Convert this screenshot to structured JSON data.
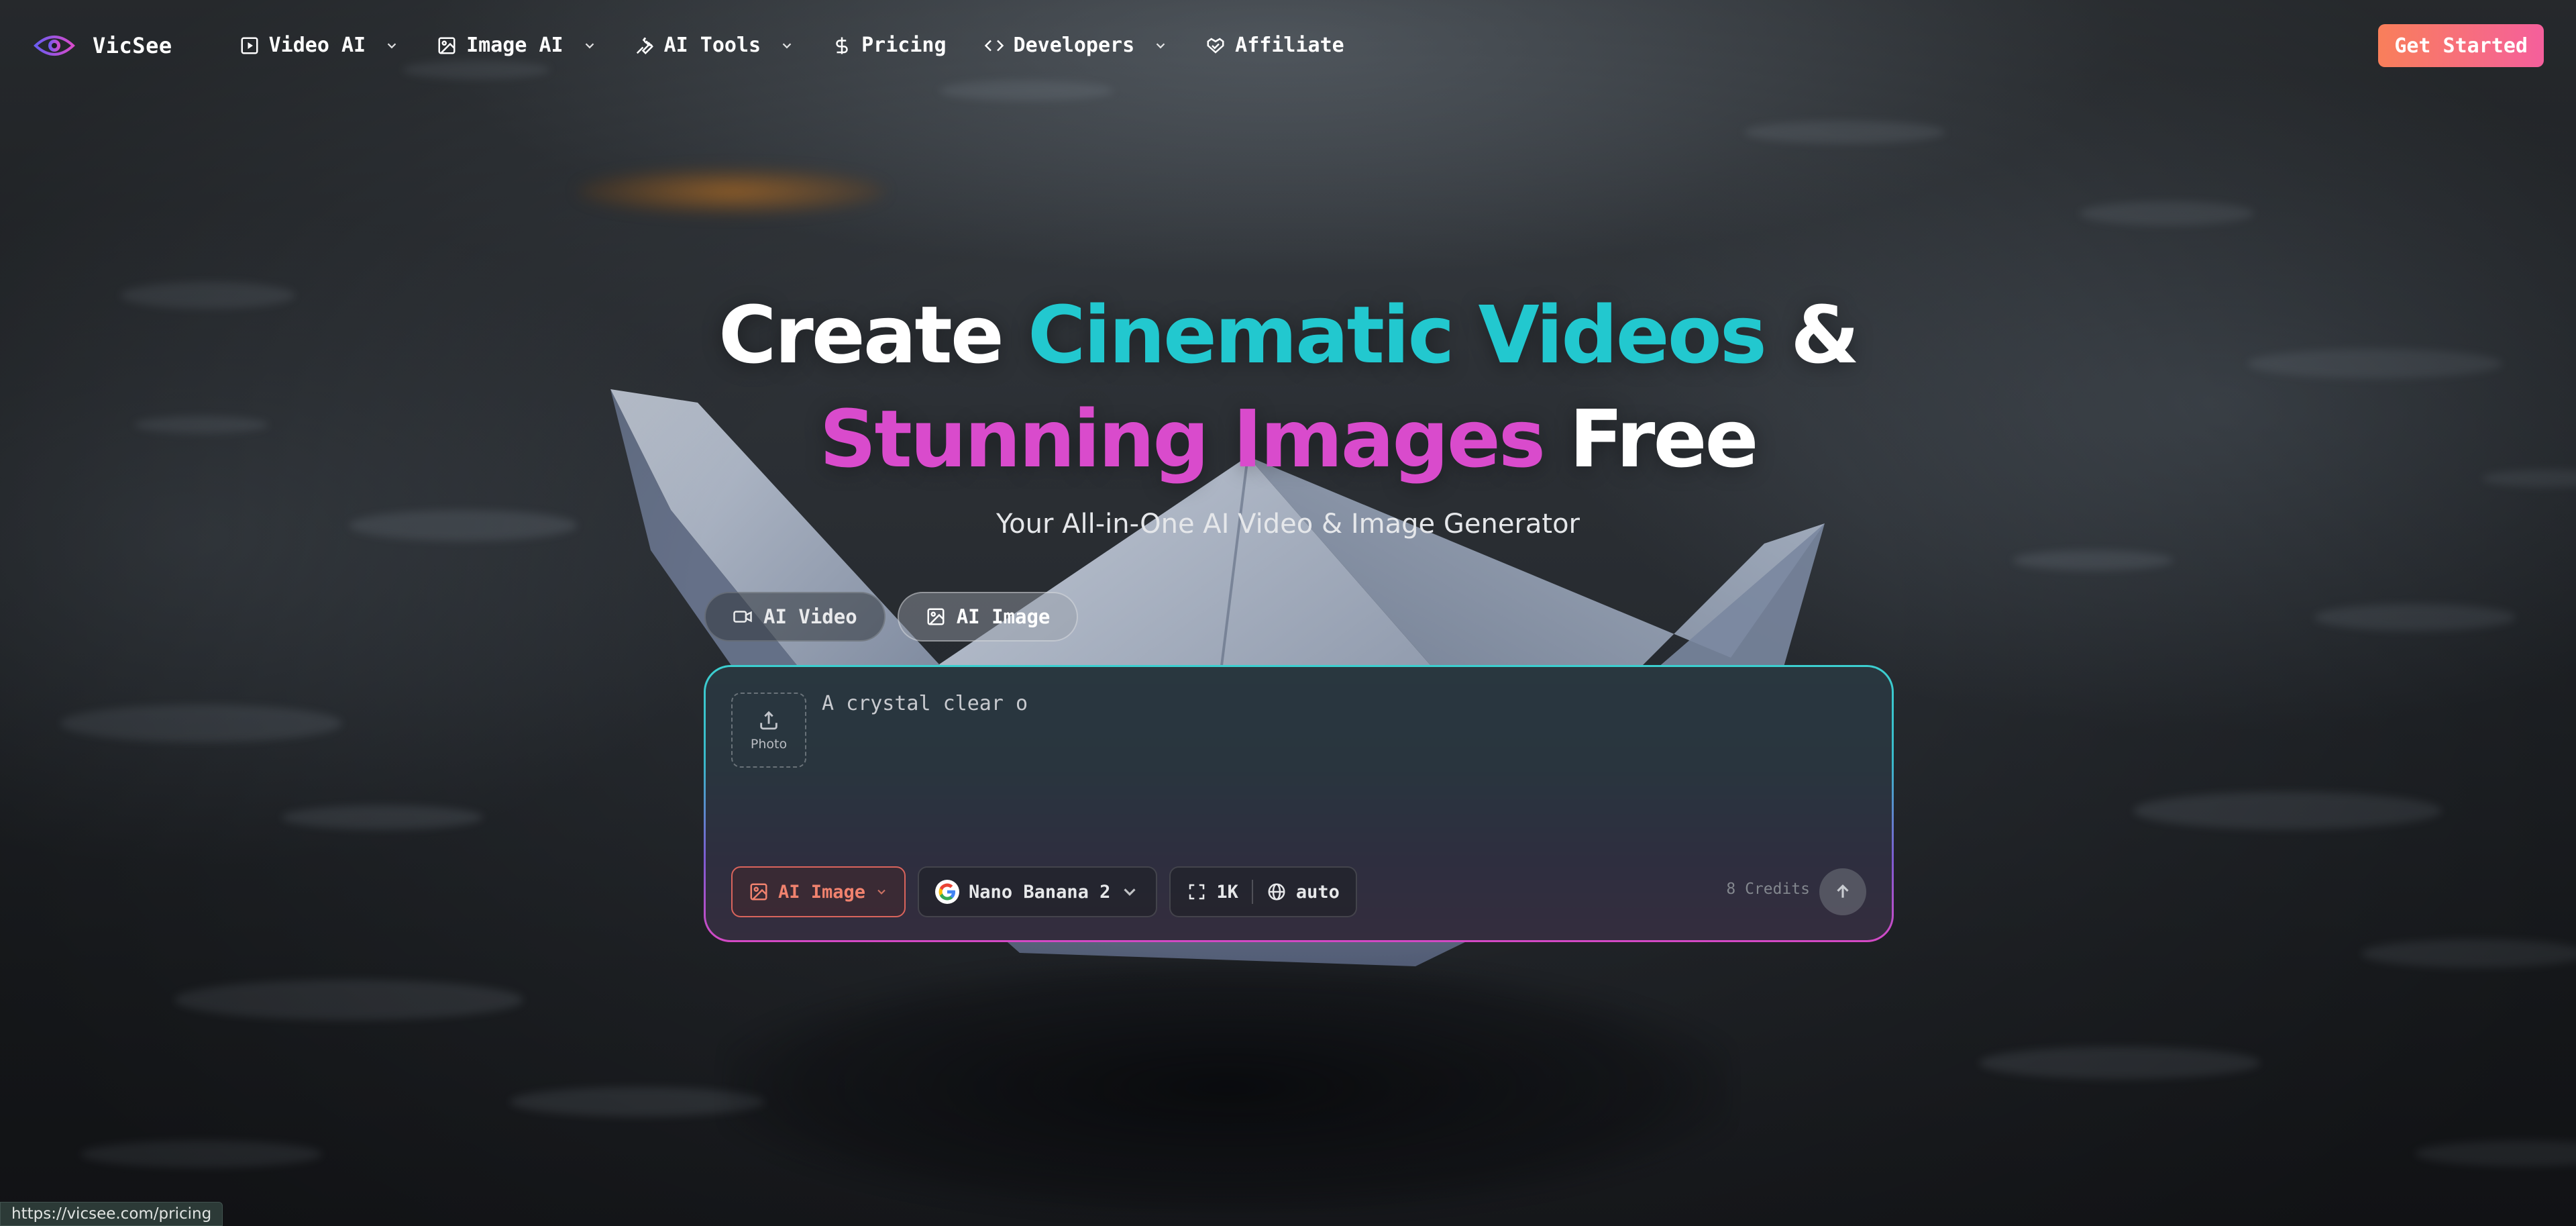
{
  "brand": {
    "name": "VicSee"
  },
  "nav": {
    "items": [
      {
        "label": "Video AI"
      },
      {
        "label": "Image AI"
      },
      {
        "label": "AI Tools"
      },
      {
        "label": "Pricing"
      },
      {
        "label": "Developers"
      },
      {
        "label": "Affiliate"
      }
    ],
    "cta_label": "Get Started"
  },
  "hero": {
    "line1_a": "Create ",
    "line1_b": "Cinematic Videos",
    "line1_c": " &",
    "line2_a": "Stunning Images",
    "line2_b": " Free",
    "subtitle": "Your All-in-One AI Video & Image Generator"
  },
  "mode_tabs": [
    {
      "label": "AI Video",
      "active": false
    },
    {
      "label": "AI Image",
      "active": true
    }
  ],
  "composer": {
    "upload_label": "Photo",
    "prompt_value": "A crystal clear o",
    "model_type": "AI Image",
    "model_name": "Nano Banana 2",
    "resolution": "1K",
    "aspect": "auto",
    "credits": "8 Credits"
  },
  "status": {
    "url": "https://vicsee.com/pricing"
  },
  "colors": {
    "accent_cyan": "#22c8cf",
    "accent_magenta": "#d94bcc",
    "cta_gradient_start": "#f97f5a",
    "cta_gradient_end": "#f55f9c"
  }
}
